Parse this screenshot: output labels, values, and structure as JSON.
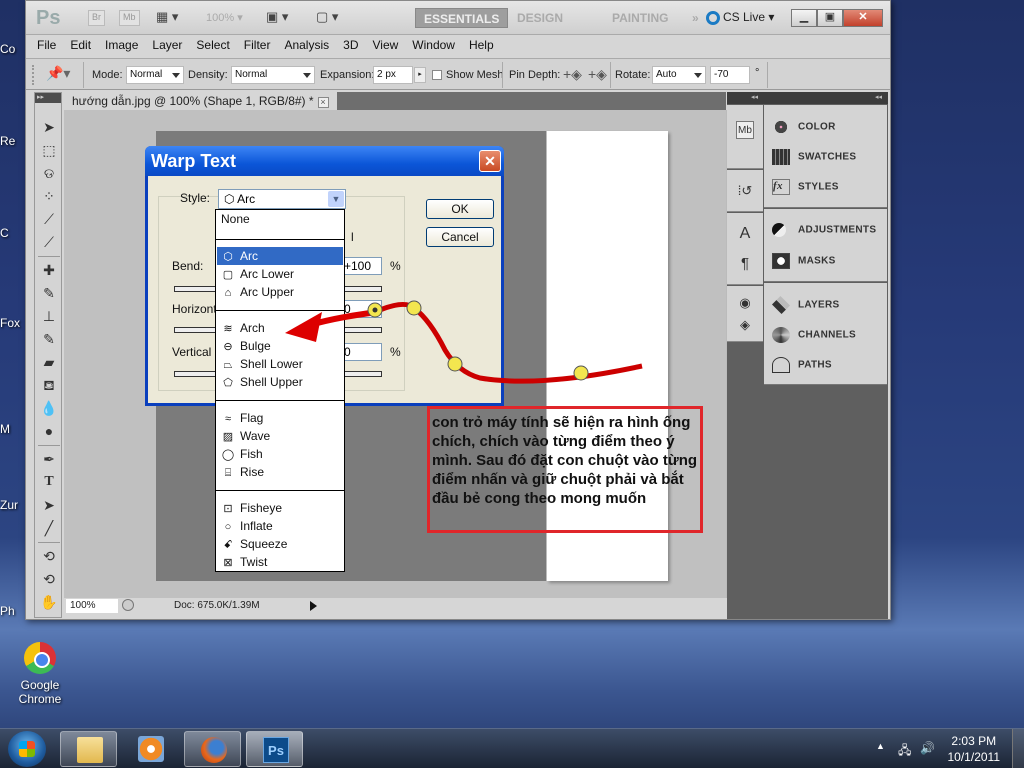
{
  "desktop": {
    "side_labels": [
      "Co",
      "Re",
      "C",
      "Fox",
      "M",
      "Zur",
      "Ph"
    ],
    "chrome_shortcut": "Google Chrome"
  },
  "appbar": {
    "logo": "Ps",
    "bridge": "Br",
    "mini_bridge": "Mb",
    "zoom_level": "100%",
    "workspaces": [
      "ESSENTIALS",
      "DESIGN",
      "PAINTING"
    ],
    "more_workspaces": "»",
    "cs_live": "CS Live"
  },
  "menu": [
    "File",
    "Edit",
    "Image",
    "Layer",
    "Select",
    "Filter",
    "Analysis",
    "3D",
    "View",
    "Window",
    "Help"
  ],
  "options": {
    "mode_label": "Mode:",
    "mode_value": "Normal",
    "density_label": "Density:",
    "density_value": "Normal",
    "expansion_label": "Expansion:",
    "expansion_value": "2 px",
    "show_mesh_label": "Show Mesh",
    "show_mesh_checked": false,
    "pin_depth_label": "Pin Depth:",
    "rotate_label": "Rotate:",
    "rotate_mode": "Auto",
    "rotate_value": "-70",
    "degree": "°"
  },
  "document": {
    "tab_title": "hướng dẫn.jpg @ 100% (Shape 1, RGB/8#) *",
    "close": "×",
    "zoom": "100%",
    "doc_info": "Doc: 675.0K/1.39M"
  },
  "tools": [
    "move",
    "marquee",
    "lasso",
    "quick-select",
    "crop",
    "eyedropper",
    "healing",
    "brush",
    "stamp",
    "history-brush",
    "eraser",
    "paint-bucket",
    "blur",
    "dodge",
    "pen",
    "type",
    "path-select",
    "line",
    "3d-rotate",
    "3d-orbit",
    "hand"
  ],
  "panels": {
    "groups": [
      {
        "items": [
          "COLOR",
          "SWATCHES",
          "STYLES"
        ]
      },
      {
        "items": [
          "ADJUSTMENTS",
          "MASKS"
        ]
      },
      {
        "items": [
          "LAYERS",
          "CHANNELS",
          "PATHS"
        ]
      }
    ]
  },
  "warp_dialog": {
    "title": "Warp Text",
    "close": "✕",
    "style_label": "Style:",
    "style_value": "Arc",
    "bend_label": "Bend:",
    "bend_value": "+100",
    "horizontal_label": "Horizont",
    "horizontal_value": "0",
    "vertical_label": "Vertical",
    "vertical_value": "0",
    "percent": "%",
    "ok": "OK",
    "cancel": "Cancel",
    "orientation_hint": "l"
  },
  "style_dropdown": {
    "selected": "Arc",
    "items": [
      {
        "label": "None",
        "glyph": ""
      },
      {
        "label": "Arc",
        "glyph": "⬡"
      },
      {
        "label": "Arc Lower",
        "glyph": "▢"
      },
      {
        "label": "Arc Upper",
        "glyph": "⌂"
      },
      {
        "label": "Arch",
        "glyph": "≋"
      },
      {
        "label": "Bulge",
        "glyph": "⊖"
      },
      {
        "label": "Shell Lower",
        "glyph": "⏢"
      },
      {
        "label": "Shell Upper",
        "glyph": "⬠"
      },
      {
        "label": "Flag",
        "glyph": "≈"
      },
      {
        "label": "Wave",
        "glyph": "▨"
      },
      {
        "label": "Fish",
        "glyph": "◯"
      },
      {
        "label": "Rise",
        "glyph": "⌸"
      },
      {
        "label": "Fisheye",
        "glyph": "⊡"
      },
      {
        "label": "Inflate",
        "glyph": "○"
      },
      {
        "label": "Squeeze",
        "glyph": "ꗃ"
      },
      {
        "label": "Twist",
        "glyph": "⊠"
      }
    ]
  },
  "annotation": {
    "text": "con trỏ máy tính sẽ hiện ra hình ống chích, chích vào từng điểm theo ý mình. Sau đó đặt con chuột vào từng điểm nhấn và giữ chuột phải và bắt đầu bẻ cong theo mong muốn",
    "border_color": "#e0262a"
  },
  "taskbar": {
    "apps": [
      "Windows Explorer",
      "Windows Media Player",
      "Firefox",
      "Photoshop"
    ],
    "active_app": "Photoshop",
    "time": "2:03 PM",
    "date": "10/1/2011"
  }
}
